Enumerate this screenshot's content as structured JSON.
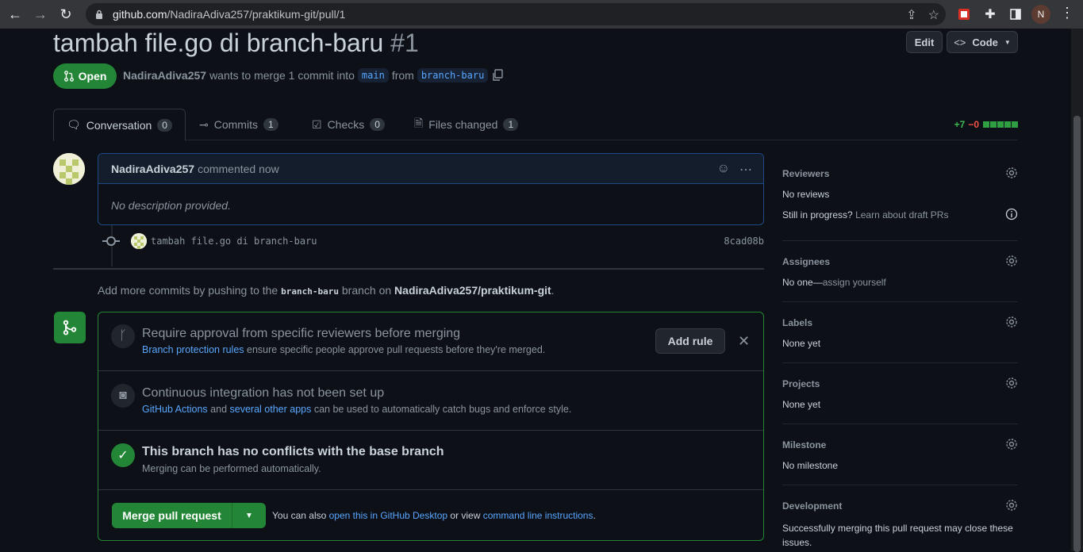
{
  "browser": {
    "url_domain": "github.com",
    "url_path": "/NadiraAdiva257/praktikum-git/pull/1",
    "profile_initial": "N"
  },
  "pr": {
    "title": "tambah file.go di branch-baru",
    "number": "#1",
    "edit_label": "Edit",
    "code_label": "Code",
    "state_label": "Open",
    "author": "NadiraAdiva257",
    "merge_text": "wants to merge 1 commit into",
    "base_branch": "main",
    "from_text": "from",
    "head_branch": "branch-baru"
  },
  "tabs": [
    {
      "label": "Conversation",
      "count": "0"
    },
    {
      "label": "Commits",
      "count": "1"
    },
    {
      "label": "Checks",
      "count": "0"
    },
    {
      "label": "Files changed",
      "count": "1"
    }
  ],
  "diffstat": {
    "additions": "+7",
    "deletions": "−0"
  },
  "comment": {
    "author": "NadiraAdiva257",
    "action": "commented now",
    "body": "No description provided."
  },
  "commit": {
    "message": "tambah file.go di branch-baru",
    "sha": "8cad08b"
  },
  "push_hint": {
    "prefix": "Add more commits by pushing to the",
    "branch": "branch-baru",
    "middle": "branch on",
    "repo": "NadiraAdiva257/praktikum-git",
    "suffix": "."
  },
  "mergebox": {
    "approval_title": "Require approval from specific reviewers before merging",
    "approval_link": "Branch protection rules",
    "approval_text": "ensure specific people approve pull requests before they're merged.",
    "add_rule_label": "Add rule",
    "ci_title": "Continuous integration has not been set up",
    "ci_link1": "GitHub Actions",
    "ci_and": "and",
    "ci_link2": "several other apps",
    "ci_text": "can be used to automatically catch bugs and enforce style.",
    "conflict_title": "This branch has no conflicts with the base branch",
    "conflict_sub": "Merging can be performed automatically.",
    "merge_label": "Merge pull request",
    "alt_prefix": "You can also",
    "alt_link1": "open this in GitHub Desktop",
    "alt_mid": "or view",
    "alt_link2": "command line instructions",
    "alt_suffix": "."
  },
  "sidebar": {
    "reviewers_title": "Reviewers",
    "reviewers_value": "No reviews",
    "reviewers_progress": "Still in progress?",
    "reviewers_learn": "Learn about draft PRs",
    "assignees_title": "Assignees",
    "assignees_value": "No one—",
    "assignees_link": "assign yourself",
    "labels_title": "Labels",
    "labels_value": "None yet",
    "projects_title": "Projects",
    "projects_value": "None yet",
    "milestone_title": "Milestone",
    "milestone_value": "No milestone",
    "development_title": "Development",
    "development_value": "Successfully merging this pull request may close these issues."
  },
  "colors": {
    "accent": "#58a6ff",
    "success": "#238636",
    "bg": "#0d1117"
  }
}
